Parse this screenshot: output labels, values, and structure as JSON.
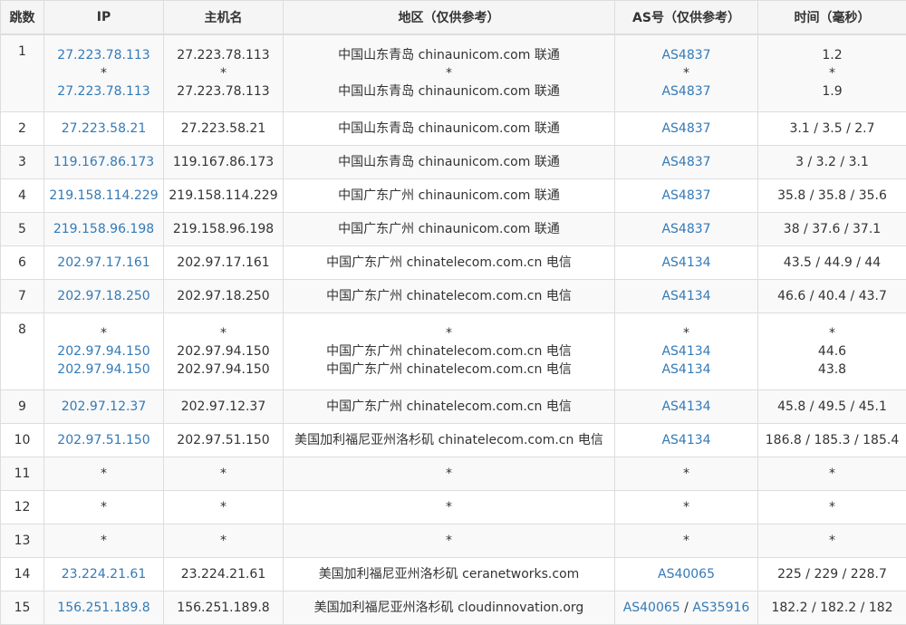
{
  "headers": {
    "hop": "跳数",
    "ip": "IP",
    "host": "主机名",
    "region": "地区（仅供参考）",
    "as": "AS号（仅供参考）",
    "time": "时间（毫秒）"
  },
  "colors": {
    "link": "#337ab7",
    "text": "#333333",
    "border": "#dddddd",
    "stripe": "#f9f9f9"
  },
  "rows": [
    {
      "hop": "1",
      "lines": [
        {
          "ip": "27.223.78.113",
          "host": "27.223.78.113",
          "region": "中国山东青岛 chinaunicom.com 联通",
          "as": [
            "AS4837"
          ],
          "time": "1.2"
        },
        {
          "ip": "*",
          "host": "*",
          "region": "*",
          "as": [
            "*"
          ],
          "time": "*"
        },
        {
          "ip": "27.223.78.113",
          "host": "27.223.78.113",
          "region": "中国山东青岛 chinaunicom.com 联通",
          "as": [
            "AS4837"
          ],
          "time": "1.9"
        }
      ]
    },
    {
      "hop": "2",
      "lines": [
        {
          "ip": "27.223.58.21",
          "host": "27.223.58.21",
          "region": "中国山东青岛 chinaunicom.com 联通",
          "as": [
            "AS4837"
          ],
          "time": "3.1 / 3.5 / 2.7"
        }
      ]
    },
    {
      "hop": "3",
      "lines": [
        {
          "ip": "119.167.86.173",
          "host": "119.167.86.173",
          "region": "中国山东青岛 chinaunicom.com 联通",
          "as": [
            "AS4837"
          ],
          "time": "3 / 3.2 / 3.1"
        }
      ]
    },
    {
      "hop": "4",
      "lines": [
        {
          "ip": "219.158.114.229",
          "host": "219.158.114.229",
          "region": "中国广东广州 chinaunicom.com 联通",
          "as": [
            "AS4837"
          ],
          "time": "35.8 / 35.8 / 35.6"
        }
      ]
    },
    {
      "hop": "5",
      "lines": [
        {
          "ip": "219.158.96.198",
          "host": "219.158.96.198",
          "region": "中国广东广州 chinaunicom.com 联通",
          "as": [
            "AS4837"
          ],
          "time": "38 / 37.6 / 37.1"
        }
      ]
    },
    {
      "hop": "6",
      "lines": [
        {
          "ip": "202.97.17.161",
          "host": "202.97.17.161",
          "region": "中国广东广州 chinatelecom.com.cn 电信",
          "as": [
            "AS4134"
          ],
          "time": "43.5 / 44.9 / 44"
        }
      ]
    },
    {
      "hop": "7",
      "lines": [
        {
          "ip": "202.97.18.250",
          "host": "202.97.18.250",
          "region": "中国广东广州 chinatelecom.com.cn 电信",
          "as": [
            "AS4134"
          ],
          "time": "46.6 / 40.4 / 43.7"
        }
      ]
    },
    {
      "hop": "8",
      "lines": [
        {
          "ip": "*",
          "host": "*",
          "region": "*",
          "as": [
            "*"
          ],
          "time": "*"
        },
        {
          "ip": "202.97.94.150",
          "host": "202.97.94.150",
          "region": "中国广东广州 chinatelecom.com.cn 电信",
          "as": [
            "AS4134"
          ],
          "time": "44.6"
        },
        {
          "ip": "202.97.94.150",
          "host": "202.97.94.150",
          "region": "中国广东广州 chinatelecom.com.cn 电信",
          "as": [
            "AS4134"
          ],
          "time": "43.8"
        }
      ]
    },
    {
      "hop": "9",
      "lines": [
        {
          "ip": "202.97.12.37",
          "host": "202.97.12.37",
          "region": "中国广东广州 chinatelecom.com.cn 电信",
          "as": [
            "AS4134"
          ],
          "time": "45.8 / 49.5 / 45.1"
        }
      ]
    },
    {
      "hop": "10",
      "lines": [
        {
          "ip": "202.97.51.150",
          "host": "202.97.51.150",
          "region": "美国加利福尼亚州洛杉矶 chinatelecom.com.cn 电信",
          "as": [
            "AS4134"
          ],
          "time": "186.8 / 185.3 / 185.4"
        }
      ]
    },
    {
      "hop": "11",
      "lines": [
        {
          "ip": "*",
          "host": "*",
          "region": "*",
          "as": [
            "*"
          ],
          "time": "*"
        }
      ]
    },
    {
      "hop": "12",
      "lines": [
        {
          "ip": "*",
          "host": "*",
          "region": "*",
          "as": [
            "*"
          ],
          "time": "*"
        }
      ]
    },
    {
      "hop": "13",
      "lines": [
        {
          "ip": "*",
          "host": "*",
          "region": "*",
          "as": [
            "*"
          ],
          "time": "*"
        }
      ]
    },
    {
      "hop": "14",
      "lines": [
        {
          "ip": "23.224.21.61",
          "host": "23.224.21.61",
          "region": "美国加利福尼亚州洛杉矶 ceranetworks.com",
          "as": [
            "AS40065"
          ],
          "time": "225 / 229 / 228.7"
        }
      ]
    },
    {
      "hop": "15",
      "lines": [
        {
          "ip": "156.251.189.8",
          "host": "156.251.189.8",
          "region": "美国加利福尼亚州洛杉矶 cloudinnovation.org",
          "as": [
            "AS40065",
            "AS35916"
          ],
          "time": "182.2 / 182.2 / 182"
        }
      ]
    }
  ]
}
